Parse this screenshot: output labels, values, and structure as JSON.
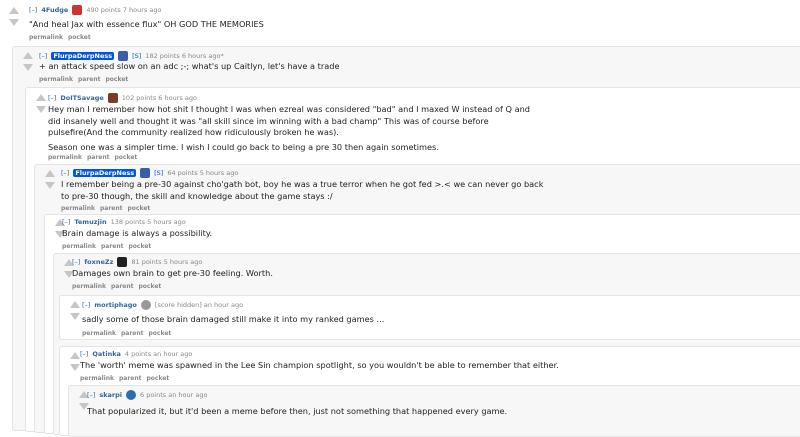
{
  "buttons": {
    "permalink": "permalink",
    "parent": "parent",
    "pocket": "pocket"
  },
  "comments": [
    {
      "expand": "[–]",
      "author": "4Fudge",
      "points": "490 points 7 hours ago",
      "lines": [
        "\"And heal Jax with essence flux\" OH GOD THE MEMORIES"
      ]
    },
    {
      "expand": "[–]",
      "author": "FlurpaDerpNess",
      "mod": "[S]",
      "points": "182 points 6 hours ago*",
      "lines": [
        "+ an attack speed slow on an adc ;-; what's up Caitlyn, let's have a trade"
      ]
    },
    {
      "expand": "[–]",
      "author": "DoITSavage",
      "points": "102 points 6 hours ago",
      "lines": [
        "Hey man I remember how hot shit I thought I was when ezreal was considered \"bad\" and I maxed W instead of Q and",
        "did insanely well and thought it was \"all skill since im winning with a bad champ\" This was of course before",
        "pulsefire(And the community realized how ridiculously broken he was).",
        "Season one was a simpler time. I wish I could go back to being a pre 30 then again sometimes."
      ]
    },
    {
      "expand": "[–]",
      "author": "FlurpaDerpNess",
      "mod": "[S]",
      "points": "64 points 5 hours ago",
      "lines": [
        "I remember being a pre-30 against cho'gath bot, boy he was a true terror when he got fed >.< we can never go back",
        "to pre-30 though, the skill and knowledge about the game stays :/"
      ]
    },
    {
      "expand": "[–]",
      "author": "Temuzjin",
      "points": "138 points 5 hours ago",
      "lines": [
        "Brain damage is always a possibility."
      ]
    },
    {
      "expand": "[–]",
      "author": "foxneZz",
      "points": "81 points 5 hours ago",
      "lines": [
        "Damages own brain to get pre-30 feeling. Worth."
      ]
    },
    {
      "expand": "[–]",
      "author": "mortiphago",
      "points": "[score hidden] an hour ago",
      "lines": [
        "sadly some of those brain damaged still make it into my ranked games ..."
      ]
    },
    {
      "expand": "[–]",
      "author": "Qatinka",
      "points": "4 points an hour ago",
      "lines": [
        "The 'worth' meme was spawned in the Lee Sin champion spotlight, so you wouldn't be able to remember that either."
      ]
    },
    {
      "expand": "[–]",
      "author": "skarpi",
      "points": "6 points an hour ago",
      "lines": [
        "That popularized it, but it'd been a meme before then, just not something that happened every game."
      ]
    }
  ],
  "colors": {
    "background": "#ffffff",
    "nested_bg": "#f7f7f8",
    "border": "#e4e4e4",
    "author": "#336699",
    "submitter_bg": "#0055df",
    "meta": "#888888"
  },
  "icons": [
    "upvote-arrow-icon",
    "downvote-arrow-icon",
    "flair-icon"
  ]
}
